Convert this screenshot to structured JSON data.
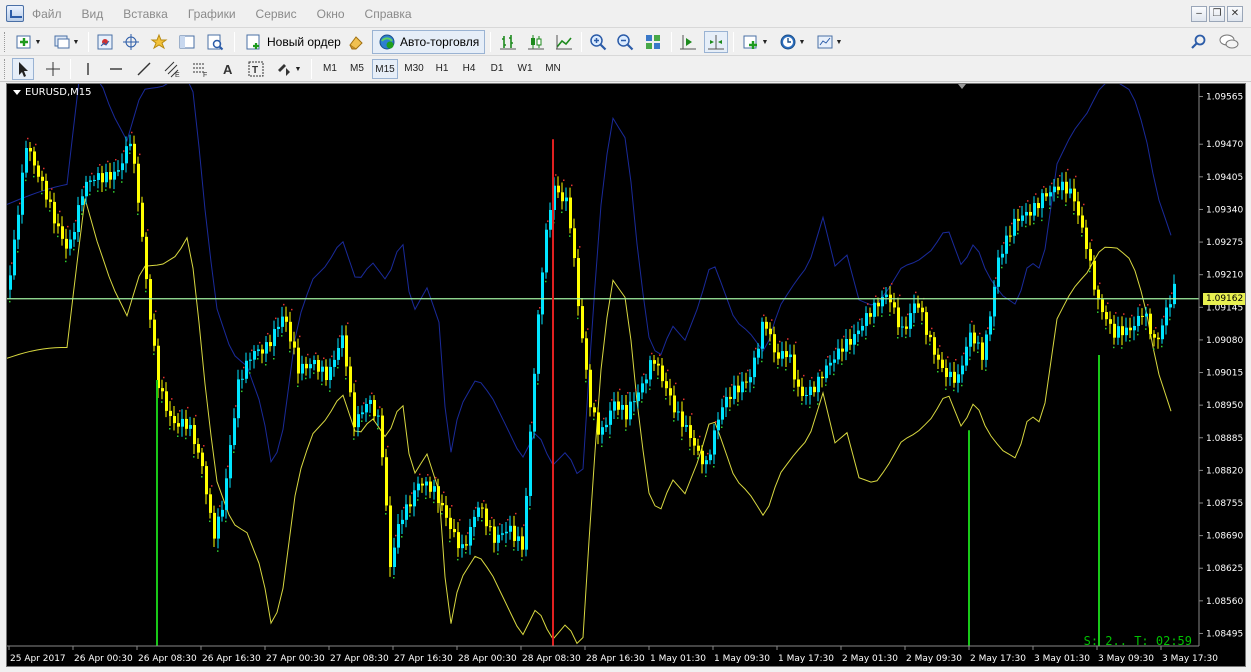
{
  "menu": {
    "items": [
      "Файл",
      "Вид",
      "Вставка",
      "Графики",
      "Сервис",
      "Окно",
      "Справка"
    ]
  },
  "toolbar": {
    "new_order_label": "Новый ордер",
    "auto_trading_label": "Авто-торговля"
  },
  "timeframes": [
    "M1",
    "M5",
    "M15",
    "M30",
    "H1",
    "H4",
    "D1",
    "W1",
    "MN"
  ],
  "active_timeframe": "M15",
  "chart": {
    "symbol": "EURUSD,M15",
    "current_price": "1.09162",
    "status_text": "S: 2.. T: 02:59",
    "price_ticks": [
      "1.09565",
      "1.09470",
      "1.09405",
      "1.09340",
      "1.09275",
      "1.09210",
      "1.09145",
      "1.09080",
      "1.09015",
      "1.08950",
      "1.08885",
      "1.08820",
      "1.08755",
      "1.08690",
      "1.08625",
      "1.08560",
      "1.08495"
    ],
    "time_ticks": [
      "25 Apr 2017",
      "26 Apr 00:30",
      "26 Apr 08:30",
      "26 Apr 16:30",
      "27 Apr 00:30",
      "27 Apr 08:30",
      "27 Apr 16:30",
      "28 Apr 00:30",
      "28 Apr 08:30",
      "28 Apr 16:30",
      "1 May 01:30",
      "1 May 09:30",
      "1 May 17:30",
      "2 May 01:30",
      "2 May 09:30",
      "2 May 17:30",
      "3 May 01:30",
      "3 May 09:30",
      "3 May 17:30"
    ],
    "colors": {
      "background": "#000000",
      "bull": "#00e5ff",
      "bear": "#ffff00",
      "upper_band": "#1a2a9a",
      "lower_band": "#d8d840",
      "price_line": "#a0f0a0",
      "signal_line": "#18c818",
      "red_line": "#e02020"
    }
  }
}
